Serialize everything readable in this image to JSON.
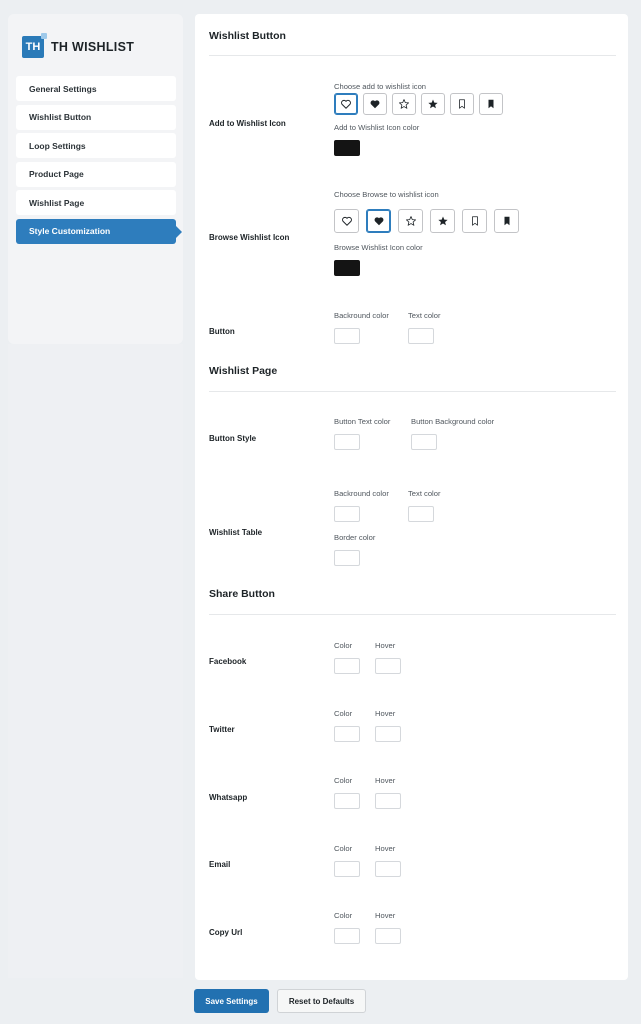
{
  "logo": {
    "badge": "TH",
    "text": "TH WISHLIST"
  },
  "nav": [
    {
      "label": "General Settings"
    },
    {
      "label": "Wishlist Button"
    },
    {
      "label": "Loop Settings"
    },
    {
      "label": "Product Page"
    },
    {
      "label": "Wishlist Page"
    },
    {
      "label": "Style Customization",
      "active": true
    }
  ],
  "wishlist_button": {
    "title": "Wishlist Button",
    "add_label": "Add to Wishlist Icon",
    "add_icon_caption": "Choose add to wishlist icon",
    "add_color_caption": "Add to Wishlist Icon color",
    "browse_label": "Browse Wishlist Icon",
    "browse_icon_caption": "Choose Browse to wishlist icon",
    "browse_color_caption": "Browse Wishlist Icon color",
    "button_label": "Button",
    "bg_caption": "Backround color",
    "text_caption": "Text color",
    "icons": [
      "heart-outline-icon",
      "heart-filled-icon",
      "star-outline-icon",
      "star-filled-icon",
      "bookmark-outline-icon",
      "bookmark-filled-icon"
    ],
    "add_selected": "heart-outline-icon",
    "browse_selected": "heart-filled-icon",
    "icon_color": "#141414"
  },
  "wishlist_page": {
    "title": "Wishlist Page",
    "button_style_label": "Button Style",
    "btn_text_caption": "Button Text color",
    "btn_bg_caption": "Button Background color",
    "table_label": "Wishlist Table",
    "table_bg_caption": "Backround color",
    "table_text_caption": "Text color",
    "border_caption": "Border color"
  },
  "share_button": {
    "title": "Share Button",
    "color_caption": "Color",
    "hover_caption": "Hover",
    "rows": [
      {
        "label": "Facebook"
      },
      {
        "label": "Twitter"
      },
      {
        "label": "Whatsapp"
      },
      {
        "label": "Email"
      },
      {
        "label": "Copy Url"
      }
    ]
  },
  "footer": {
    "save_label": "Save Settings",
    "reset_label": "Reset to Defaults"
  },
  "colors": {
    "accent": "#2e7dbd",
    "save_button": "#2271b1"
  }
}
